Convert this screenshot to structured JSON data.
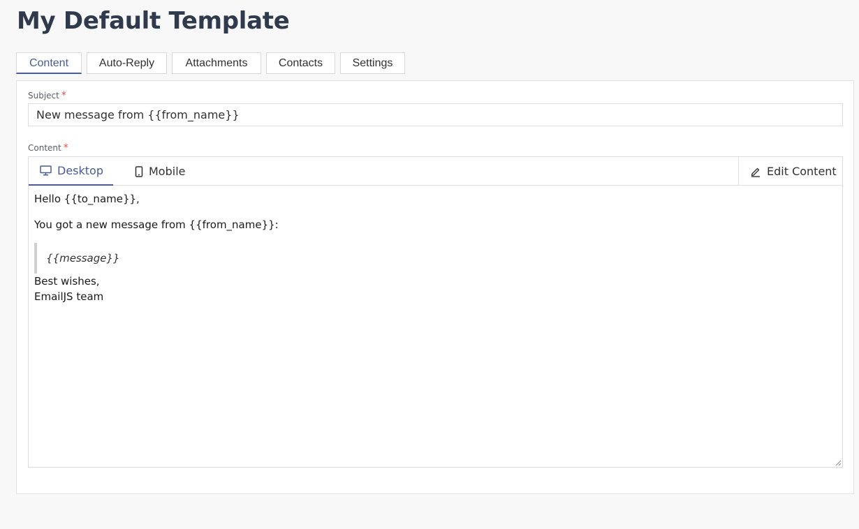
{
  "page": {
    "title": "My Default Template"
  },
  "tabs": [
    {
      "label": "Content",
      "active": true
    },
    {
      "label": "Auto-Reply",
      "active": false
    },
    {
      "label": "Attachments",
      "active": false
    },
    {
      "label": "Contacts",
      "active": false
    },
    {
      "label": "Settings",
      "active": false
    }
  ],
  "subject": {
    "label": "Subject",
    "required_mark": "*",
    "value": "New message from {{from_name}}"
  },
  "content": {
    "label": "Content",
    "required_mark": "*",
    "view_tabs": {
      "desktop": "Desktop",
      "mobile": "Mobile",
      "edit": "Edit Content"
    },
    "body": {
      "greeting": "Hello {{to_name}},",
      "intro": "You got a new message from {{from_name}}:",
      "quote": "{{message}}",
      "closing": "Best wishes,",
      "signature": "EmailJS team"
    }
  },
  "colors": {
    "accent": "#4a5a96",
    "required": "#e34d4d",
    "title": "#2f3b4c"
  },
  "icons": {
    "desktop": "monitor-icon",
    "mobile": "smartphone-icon",
    "edit": "pencil-icon",
    "resize": "resize-handle-icon"
  }
}
